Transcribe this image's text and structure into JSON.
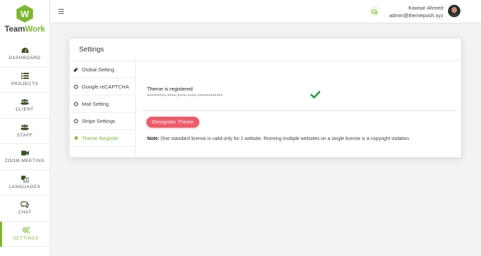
{
  "colors": {
    "accent": "#7cb82f",
    "danger": "#ef5a6b",
    "success": "#1e9e2e"
  },
  "brand": {
    "logo_letter": "W",
    "name_start": "Team",
    "name_accent": "Work"
  },
  "sidebar": {
    "items": [
      {
        "label": "DASHBOARD",
        "icon": "dashboard-icon"
      },
      {
        "label": "PROJECTS",
        "icon": "list-icon"
      },
      {
        "label": "CLIENT",
        "icon": "users-icon"
      },
      {
        "label": "STAFF",
        "icon": "users-icon"
      },
      {
        "label": "ZOOM MEETING",
        "icon": "video-camera-icon"
      },
      {
        "label": "LANGUAGES",
        "icon": "translate-icon"
      },
      {
        "label": "CHAT",
        "icon": "chat-icon"
      },
      {
        "label": "SETTINGS",
        "icon": "gears-icon",
        "active": true
      }
    ]
  },
  "topbar": {
    "user_name": "Kawsar Ahmed",
    "user_email": "admin@themeposh.xyz"
  },
  "card": {
    "title": "Settings",
    "nav": [
      {
        "label": "Global Setting",
        "icon": "wrench-icon"
      },
      {
        "label": "Google reCAPTCHA",
        "icon": "gear-icon"
      },
      {
        "label": "Mail Setting",
        "icon": "gear-icon"
      },
      {
        "label": "Stripe Settings",
        "icon": "gear-icon"
      },
      {
        "label": "Theme Register",
        "icon": "circle-icon",
        "active": true
      }
    ],
    "content": {
      "registered_text": "Theme is registered",
      "license_key": "*********-****-****-****-************",
      "deregister_button": "Deregister Theme",
      "note_label": "Note:",
      "note_text": "One standard license is valid only for 1 website. Running multiple websites on a single license is a copyright violation."
    }
  }
}
